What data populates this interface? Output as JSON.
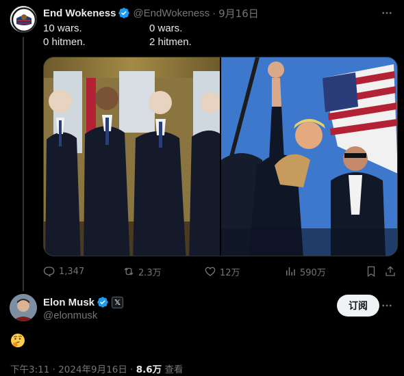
{
  "colors": {
    "background": "#000000",
    "text_primary": "#e7e9ea",
    "text_secondary": "#71767b",
    "verified_blue": "#1d9bf0",
    "follow_button_bg": "#eff3f4"
  },
  "original_tweet": {
    "author_name": "End Wokeness",
    "author_handle": "@EndWokeness",
    "separator": "·",
    "timestamp": "9月16日",
    "text_col1": "10 wars.\n0 hitmen.",
    "text_col2": "0 wars.\n2 hitmen.",
    "avatar_icon": "end-wokeness-logo-icon",
    "media": [
      {
        "name": "four-presidents-photo",
        "alt": ""
      },
      {
        "name": "trump-rally-photo",
        "alt": ""
      }
    ],
    "stats": {
      "replies": "1,347",
      "reposts": "2.3万",
      "likes": "12万",
      "views": "590万"
    }
  },
  "reply": {
    "author_name": "Elon Musk",
    "author_handle": "@elonmusk",
    "affiliate_badge": "𝕏",
    "follow_label": "订阅",
    "emoji": "🤔",
    "timestamp": "下午3:11 · 2024年9月16日",
    "view_count": "8.6万",
    "view_label": "查看",
    "separator": "·"
  }
}
